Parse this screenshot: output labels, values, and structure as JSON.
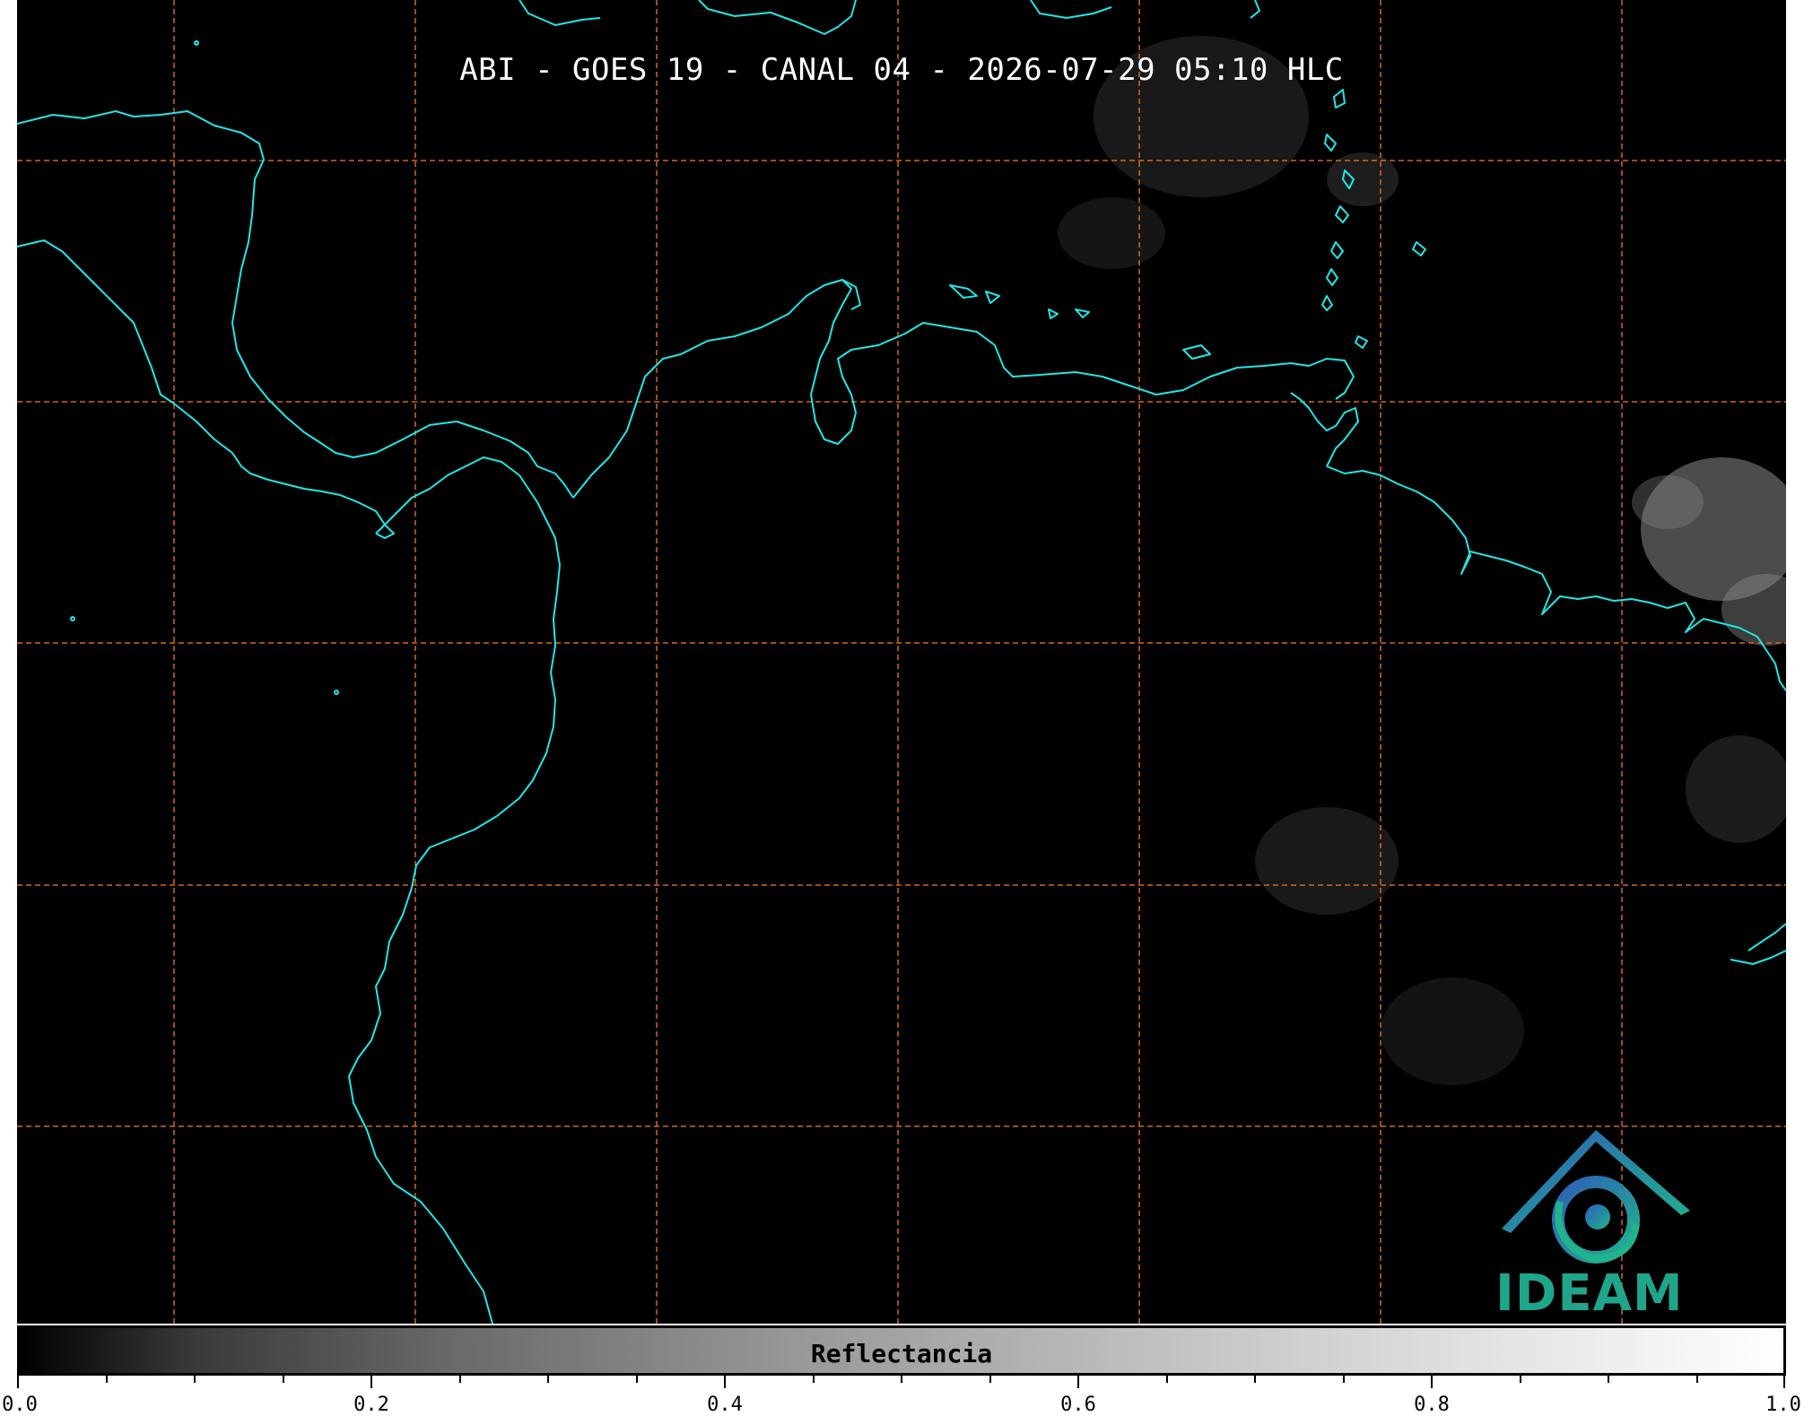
{
  "title": "ABI - GOES 19 - CANAL 04 - 2026-07-29 05:10 HLC",
  "logo_text": "IDEAM",
  "colorbar": {
    "label": "Reflectancia",
    "ticks": [
      "0.0",
      "0.2",
      "0.4",
      "0.6",
      "0.8",
      "1.0"
    ],
    "range": [
      0.0,
      1.0
    ],
    "colormap": "grayscale"
  },
  "colors": {
    "coastline": "#22e6e6",
    "grid": "#d2691e",
    "background": "#000000",
    "logo": "#1fa58a"
  },
  "icons": [
    "ideam-logo-icon"
  ]
}
